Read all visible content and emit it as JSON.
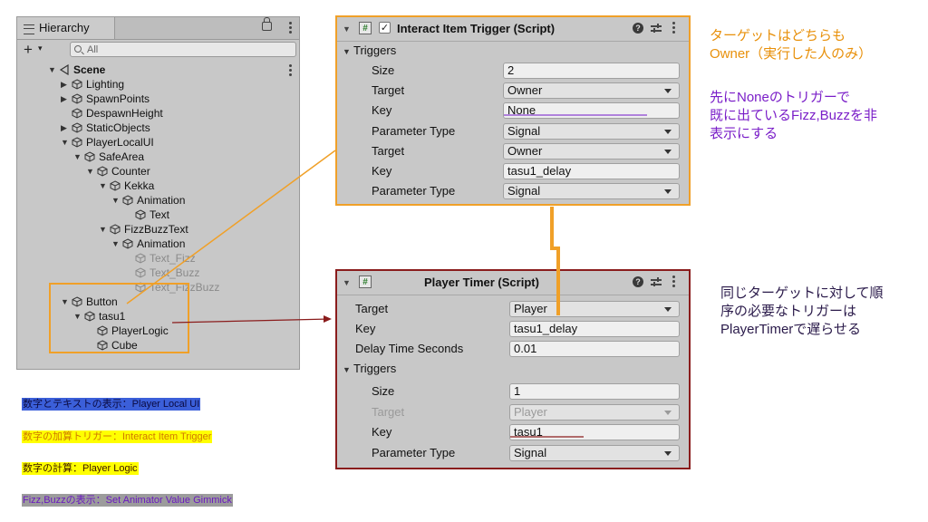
{
  "colors": {
    "orange_accent": "#f0a028",
    "darkred_accent": "#8a1c1c",
    "note_orange": "#e8900a",
    "note_purple": "#7a1ec8",
    "note_dark": "#2a1a4a",
    "legend_blue_bg": "#3b5fd9",
    "legend_yellow_bg": "#ffff00",
    "legend_purple_bg": "#9c9c9c",
    "underline_purple": "#8a40d0",
    "underline_red": "#8a1c1c"
  },
  "hierarchy": {
    "tab_label": "Hierarchy",
    "search_placeholder": "All",
    "tree": [
      {
        "label": "Scene",
        "icon": "scene-icon",
        "expanded": true
      },
      {
        "label": "Lighting",
        "icon": "gameobject-icon",
        "expanded": false
      },
      {
        "label": "SpawnPoints",
        "icon": "gameobject-icon",
        "expanded": false
      },
      {
        "label": "DespawnHeight",
        "icon": "gameobject-icon"
      },
      {
        "label": "StaticObjects",
        "icon": "gameobject-icon",
        "expanded": false
      },
      {
        "label": "PlayerLocalUI",
        "icon": "gameobject-icon",
        "expanded": true
      },
      {
        "label": "SafeArea",
        "icon": "gameobject-icon",
        "expanded": true
      },
      {
        "label": "Counter",
        "icon": "gameobject-icon",
        "expanded": true
      },
      {
        "label": "Kekka",
        "icon": "gameobject-icon",
        "expanded": true
      },
      {
        "label": "Animation",
        "icon": "gameobject-icon",
        "expanded": true
      },
      {
        "label": "Text",
        "icon": "gameobject-icon"
      },
      {
        "label": "FizzBuzzText",
        "icon": "gameobject-icon",
        "expanded": true
      },
      {
        "label": "Animation",
        "icon": "gameobject-icon",
        "expanded": true
      },
      {
        "label": "Text_Fizz",
        "icon": "gameobject-icon",
        "inactive": true
      },
      {
        "label": "Text_Buzz",
        "icon": "gameobject-icon",
        "inactive": true
      },
      {
        "label": "Text_FizzBuzz",
        "icon": "gameobject-icon",
        "inactive": true
      },
      {
        "label": "Button",
        "icon": "gameobject-icon",
        "expanded": true
      },
      {
        "label": "tasu1",
        "icon": "gameobject-icon",
        "expanded": true
      },
      {
        "label": "PlayerLogic",
        "icon": "gameobject-icon"
      },
      {
        "label": "Cube",
        "icon": "gameobject-icon"
      }
    ]
  },
  "interact": {
    "title": "Interact Item Trigger (Script)",
    "enabled": "✓",
    "triggers_label": "Triggers",
    "props": [
      {
        "label": "Size",
        "value": "2"
      },
      {
        "label": "Target",
        "value": "Owner"
      },
      {
        "label": "Key",
        "value": "None"
      },
      {
        "label": "Parameter Type",
        "value": "Signal"
      },
      {
        "label": "Target",
        "value": "Owner"
      },
      {
        "label": "Key",
        "value": "tasu1_delay"
      },
      {
        "label": "Parameter Type",
        "value": "Signal"
      }
    ]
  },
  "timer": {
    "title": "Player Timer (Script)",
    "props": [
      {
        "label": "Target",
        "value": "Player"
      },
      {
        "label": "Key",
        "value": "tasu1_delay"
      },
      {
        "label": "Delay Time Seconds",
        "value": "0.01"
      }
    ],
    "triggers_label": "Triggers",
    "trigger_props": [
      {
        "label": "Size",
        "value": "1"
      },
      {
        "label": "Target",
        "value": "Player"
      },
      {
        "label": "Key",
        "value": "tasu1"
      },
      {
        "label": "Parameter Type",
        "value": "Signal"
      }
    ]
  },
  "notes": {
    "target_lines": [
      "ターゲットはどちらも",
      "Owner（実行した人のみ）"
    ],
    "none_lines": [
      "先にNoneのトリガーで",
      "既に出ているFizz,Buzzを非",
      "表示にする"
    ],
    "timer_lines": [
      "同じターゲットに対して順",
      "序の必要なトリガーは",
      "PlayerTimerで遅らせる"
    ]
  },
  "legend": [
    {
      "text": "数字とテキストの表示：Player Local UI"
    },
    {
      "text": "数字の加算トリガー：Interact Item Trigger"
    },
    {
      "text": "数字の計算：Player Logic"
    },
    {
      "text": "Fizz,Buzzの表示：Set Animator Value Gimmick"
    }
  ]
}
